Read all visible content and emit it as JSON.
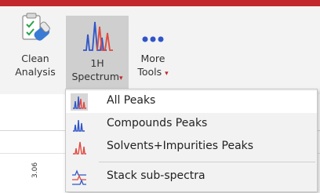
{
  "ribbon": {
    "clean": {
      "line1": "Clean",
      "line2": "Analysis",
      "icon": "clean-analysis-icon"
    },
    "spectrum": {
      "line1": "1H",
      "line2": "Spectrum",
      "icon": "spectrum-peaks-icon"
    },
    "more": {
      "line1": "More",
      "line2": "Tools",
      "icon": "ellipsis-icon"
    },
    "caret": "▾"
  },
  "menu": {
    "items": [
      {
        "label": "All Peaks",
        "icon": "all-peaks-icon"
      },
      {
        "label": "Compounds Peaks",
        "icon": "compounds-peaks-icon"
      },
      {
        "label": "Solvents+Impurities Peaks",
        "icon": "solvents-impurities-peaks-icon"
      },
      {
        "label": "Stack sub-spectra",
        "icon": "stack-sub-spectra-icon"
      }
    ]
  },
  "axis": {
    "tick": "3.06"
  },
  "colors": {
    "accent": "#c1272d",
    "peak_blue": "#2f55c8",
    "peak_red": "#e04a3f"
  }
}
